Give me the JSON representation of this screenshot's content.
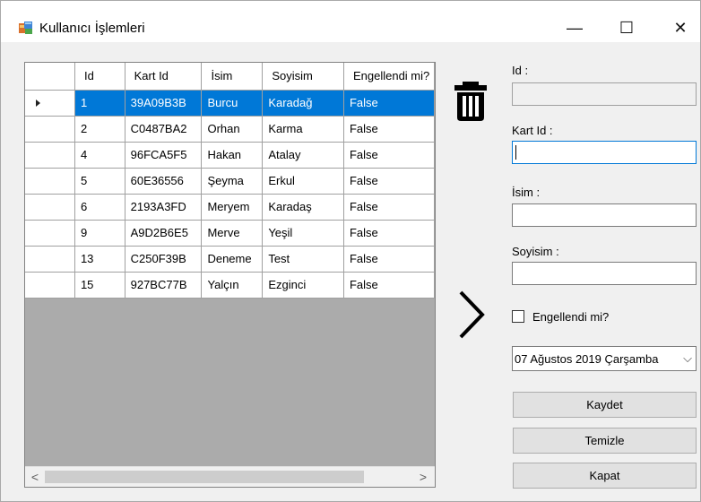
{
  "window": {
    "title": "Kullanıcı İşlemleri",
    "minimize_glyph": "—",
    "maximize_glyph": "☐",
    "close_glyph": "✕"
  },
  "grid": {
    "columns": [
      "Id",
      "Kart Id",
      "İsim",
      "Soyisim",
      "Engellendi mi?"
    ],
    "rows": [
      {
        "id": "1",
        "kart_id": "39A09B3B",
        "isim": "Burcu",
        "soyisim": "Karadağ",
        "engellendi": "False",
        "selected": true
      },
      {
        "id": "2",
        "kart_id": "C0487BA2",
        "isim": "Orhan",
        "soyisim": "Karma",
        "engellendi": "False"
      },
      {
        "id": "4",
        "kart_id": "96FCA5F5",
        "isim": "Hakan",
        "soyisim": "Atalay",
        "engellendi": "False"
      },
      {
        "id": "5",
        "kart_id": "60E36556",
        "isim": "Şeyma",
        "soyisim": "Erkul",
        "engellendi": "False"
      },
      {
        "id": "6",
        "kart_id": "2193A3FD",
        "isim": "Meryem",
        "soyisim": "Karadaş",
        "engellendi": "False"
      },
      {
        "id": "9",
        "kart_id": "A9D2B6E5",
        "isim": "Merve",
        "soyisim": "Yeşil",
        "engellendi": "False"
      },
      {
        "id": "13",
        "kart_id": "C250F39B",
        "isim": "Deneme",
        "soyisim": "Test",
        "engellendi": "False"
      },
      {
        "id": "15",
        "kart_id": "927BC77B",
        "isim": "Yalçın",
        "soyisim": "Ezginci",
        "engellendi": "False"
      }
    ],
    "scroll_left": "<",
    "scroll_right": ">"
  },
  "icons": {
    "delete": "trash-icon",
    "transfer": "chevron-right-icon"
  },
  "form": {
    "id_label": "Id :",
    "id_value": "",
    "kart_id_label": "Kart Id :",
    "kart_id_value": "",
    "isim_label": "İsim :",
    "isim_value": "",
    "soyisim_label": "Soyisim :",
    "soyisim_value": "",
    "engellendi_label": "Engellendi mi?",
    "engellendi_checked": false,
    "date_value": "07 Ağustos 2019 Çarşamba",
    "date_chevron": "⌵",
    "save_label": "Kaydet",
    "clear_label": "Temizle",
    "close_label": "Kapat"
  },
  "colors": {
    "selection": "#0078d7",
    "grid_background": "#ababab"
  }
}
